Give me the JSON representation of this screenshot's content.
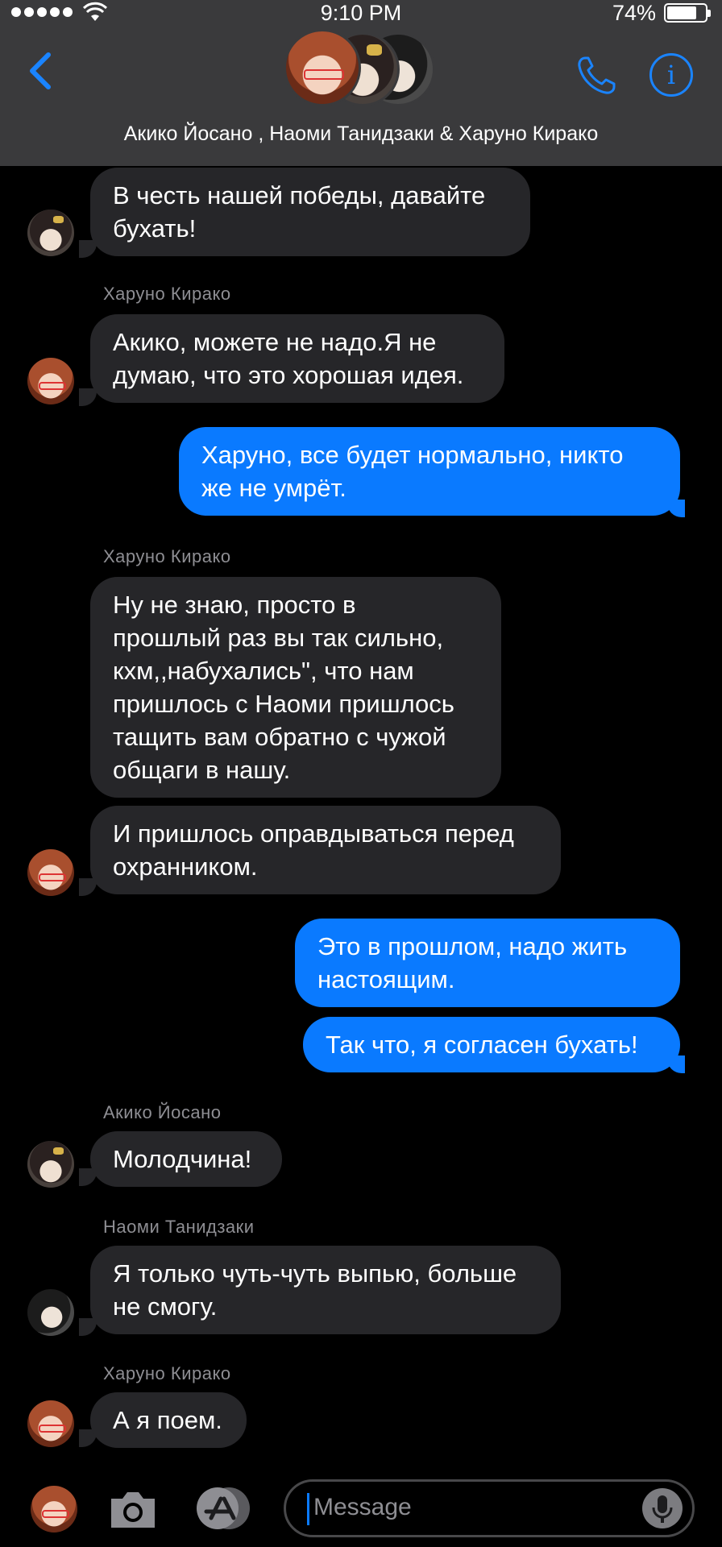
{
  "status": {
    "time": "9:10 PM",
    "battery": "74%",
    "battery_level": 0.74
  },
  "header": {
    "title": "Акико Йосано , Наоми Танидзаки & Харуно Кирако"
  },
  "messages": [
    {
      "type": "in",
      "avatar": "akiko",
      "text": "В честь нашей победы, давайте\nбухать!"
    },
    {
      "type": "sender",
      "text": "Харуно Кирако"
    },
    {
      "type": "in",
      "avatar": "haruno",
      "text": "Акико, можете не надо.Я не\nдумаю, что это хорошая идея."
    },
    {
      "type": "out",
      "text": "Харуно, все будет нормально, никто\nже не умрёт."
    },
    {
      "type": "sender",
      "text": "Харуно Кирако"
    },
    {
      "type": "in",
      "avatar": null,
      "text": "Ну не знаю, просто в\nпрошлый раз вы так сильно,\nкхм,,набухались\", что нам\nпришлось с Наоми пришлось\nтащить вам обратно с чужой\nобщаги в нашу."
    },
    {
      "type": "in",
      "avatar": "haruno",
      "text": "И пришлось оправдываться перед\nохранником."
    },
    {
      "type": "out",
      "text": "Это в прошлом, надо жить\nнастоящим."
    },
    {
      "type": "out",
      "text": "Так что, я согласен бухать!"
    },
    {
      "type": "sender",
      "text": "Акико Йосано"
    },
    {
      "type": "in",
      "avatar": "akiko",
      "text": "Молодчина!"
    },
    {
      "type": "sender",
      "text": "Наоми Танидзаки"
    },
    {
      "type": "in",
      "avatar": "naomi",
      "text": "Я только чуть-чуть выпью, больше\nне смогу."
    },
    {
      "type": "sender",
      "text": "Харуно Кирако"
    },
    {
      "type": "in",
      "avatar": "haruno",
      "text": "А я поем."
    }
  ],
  "input": {
    "placeholder": "Message"
  },
  "colors": {
    "accent": "#0a7aff",
    "incoming": "#262629",
    "header": "#3a3a3c"
  }
}
